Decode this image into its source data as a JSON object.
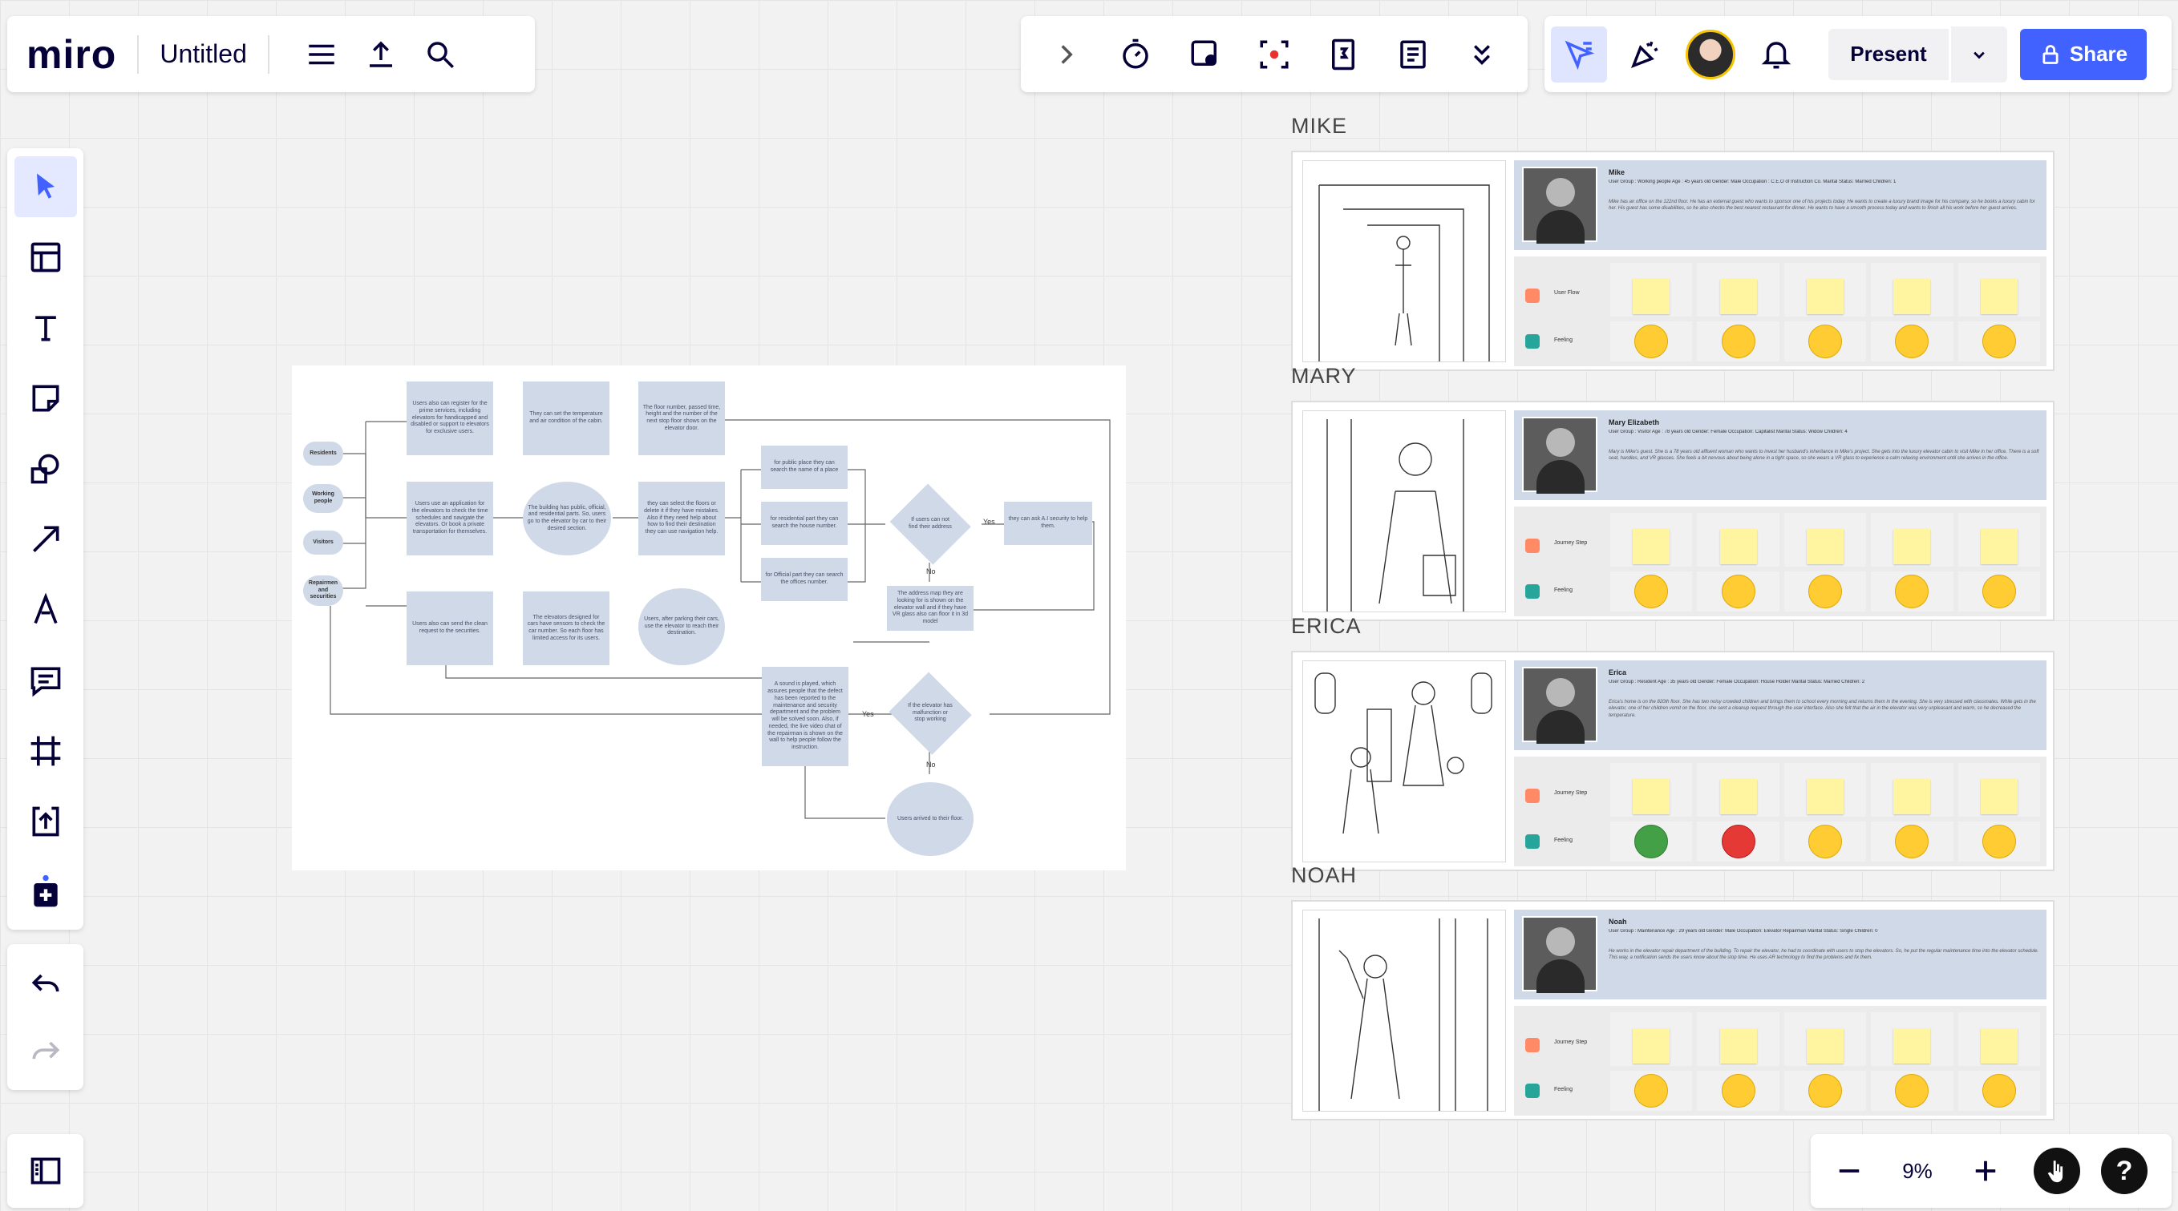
{
  "app": {
    "logo": "miro",
    "board_title": "Untitled"
  },
  "top_right": {
    "present_label": "Present",
    "share_label": "Share"
  },
  "zoom": {
    "level": "9%"
  },
  "help": "?",
  "flowchart": {
    "residents": "Residents",
    "working": "Working people",
    "visitors": "Visitors",
    "repairmen": "Repairmen and securities",
    "n1": "Users also can register for the prime services, including elevators for handicapped and disabled or support to elevators for exclusive users.",
    "n2": "Users use an application for the elevators to check the time schedules and navigate the elevators. Or book a private transportation for themselves.",
    "n3": "Users also can send the clean request to the securities.",
    "n4": "They can set the temperature and air condition of the cabin.",
    "n5": "The building has public, official, and residential parts. So, users go to the elevator by car to their desired section.",
    "n6": "The elevators designed for cars have sensors to check the car number. So each floor has limited access for its users.",
    "n7": "The floor number, passed time, height and the number of the next stop floor shows on the elevator door.",
    "n8": "they can select the floors or delete it if they have mistakes. Also if they need help about how to find their destination they can use navigation help.",
    "n9": "Users, after parking their cars, use the elevator to reach their destination.",
    "n10": "for public place they can search the name of a place",
    "n11": "for residential part they can search the house number.",
    "n12": "for Official part they can search the offices number.",
    "n13": "If users can not find their address",
    "n14": "they can ask A.I security to help them.",
    "n15": "The address map they are looking for is shown on the elevator wall and if they have VR glass also can floor it in 3d model",
    "n16": "A sound is played, which assures people that the defect has been reported to the maintenance and security department and the problem will be solved soon. Also, if needed, the live video chat of the repairman is shown on the wall to help people follow the instruction.",
    "n17": "If the elevator has malfunction or stop working",
    "n18": "Users arrived to their floor.",
    "yes1": "Yes",
    "no1": "No",
    "yes2": "Yes",
    "no2": "No"
  },
  "personas": [
    {
      "heading": "MIKE",
      "name": "Mike",
      "meta": "User Group : Working people      Age : 45 years old      Gender: Male      Occupation : C.E.O of Instruction Co.      Marital Status: Married      Children: 1",
      "bio": "Mike has an office on the 122nd floor. He has an external guest who wants to sponsor one of his projects today. He wants to create a luxury brand image for his company, so he books a luxury cabin for her. His guest has some disabilities, so he also checks the best nearest restaurant for dinner. He wants to have a smooth process today and wants to finish all his work before her guest arrives.",
      "row1": "User Flow",
      "row2": "Feeling"
    },
    {
      "heading": "MARY",
      "name": "Mary Elizabeth",
      "meta": "User Group : Visitor      Age : 78 years old      Gender: Female      Occupation: Capitalist      Marital Status: Widow      Children: 4",
      "bio": "Mary is Mike's guest. She is a 78 years old affluent woman who wants to invest her husband's inheritance in Mike's project. She gets into the luxury elevator cabin to visit Mike in her office. There is a soft seat, handles, and VR glasses. She feels a bit nervous about being alone in a tight space, so she wears a VR glass to experience a calm relaxing environment until she arrives in the office.",
      "row1": "Journey Step",
      "row2": "Feeling"
    },
    {
      "heading": "ERICA",
      "name": "Erica",
      "meta": "User Group : Resident      Age : 35 years old      Gender: Female      Occupation: House Holder      Marital Status: Married      Children: 2",
      "bio": "Erica's home is on the 820th floor. She has two noisy crowded children and brings them to school every morning and returns them in the evening. She is very stressed with classmates. While gets in the elevator, one of her children vomit on the floor, she sent a cleanup request through the user interface. Also she felt that the air in the elevator was very unpleasant and warm, so he decreased the temperature.",
      "row1": "Journey Step",
      "row2": "Feeling"
    },
    {
      "heading": "NOAH",
      "name": "Noah",
      "meta": "User Group : Maintenance      Age : 29 years old      Gender: Male      Occupation: Elevator Repairman      Marital Status: Single      Children: 0",
      "bio": "He works in the elevator repair department of the building. To repair the elevator, he had to coordinate with users to stop the elevators. So, he put the regular maintenance time into the elevator schedule. This way, a notification sends the users know about the stop time. He uses AR technology to find the problems and fix them.",
      "row1": "Journey Step",
      "row2": "Feeling"
    }
  ],
  "colors": {
    "accent": "#4262ff",
    "node": "#d0d9e8",
    "sticky": "#fff5a0"
  }
}
